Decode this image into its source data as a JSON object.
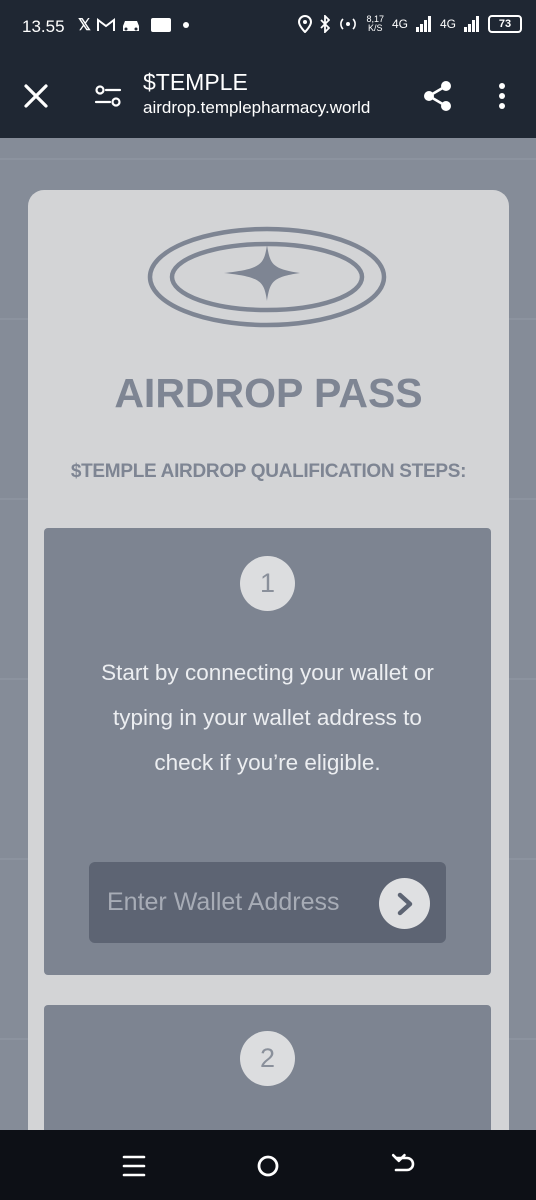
{
  "status_bar": {
    "time": "13.55",
    "network_speed_value": "8,17",
    "network_speed_unit": "K/S",
    "sim1_label": "4G",
    "sim2_label": "4G",
    "battery_level": "73",
    "icons": [
      "x-icon",
      "gmail-icon",
      "car-icon",
      "app-icon",
      "dot-icon",
      "location-icon",
      "bluetooth-icon",
      "hotspot-icon",
      "signal-icon",
      "battery-icon"
    ]
  },
  "browser": {
    "title": "$TEMPLE",
    "url": "airdrop.templepharmacy.world"
  },
  "card": {
    "title": "AIRDROP PASS",
    "steps_heading": "$TEMPLE AIRDROP QUALIFICATION STEPS:",
    "steps": [
      {
        "number": "1",
        "text": "Start by connecting your wallet or typing in your wallet address to check if you’re eligible."
      },
      {
        "number": "2"
      }
    ],
    "wallet_input": {
      "placeholder": "Enter Wallet Address",
      "value": ""
    }
  },
  "colors": {
    "chrome": "#1f2733",
    "page_bg": "#858c98",
    "card_bg": "#d3d4d6",
    "accent": "#7e8593",
    "step_bg": "#7d8491",
    "input_bg": "#5d6473"
  }
}
